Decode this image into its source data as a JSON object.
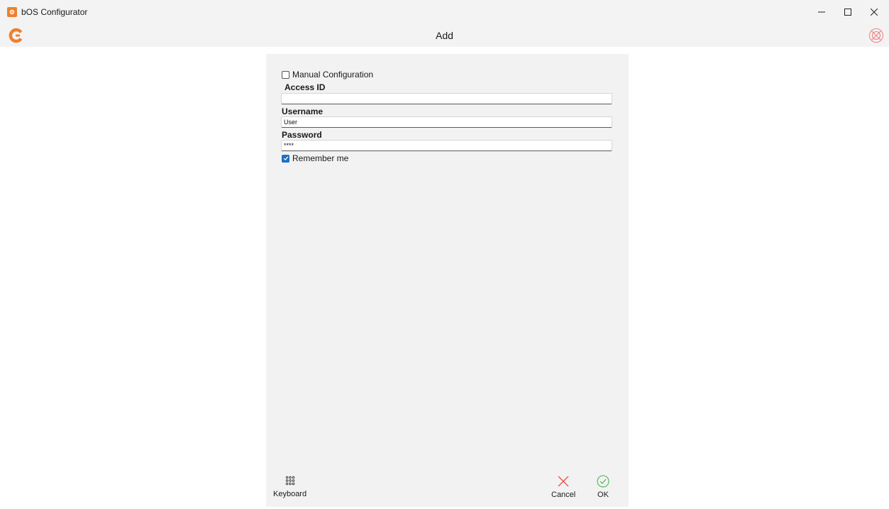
{
  "window": {
    "title": "bOS Configurator",
    "controls": [
      "minimize-icon",
      "maximize-icon",
      "close-icon"
    ]
  },
  "header": {
    "title": "Add",
    "logo_icon": "app-logo-icon",
    "power_icon": "power-close-icon"
  },
  "form": {
    "manual_config_label": "Manual Configuration",
    "manual_config_checked": false,
    "access_id_label": "Access ID",
    "access_id_value": "",
    "username_label": "Username",
    "username_value": "User",
    "password_label": "Password",
    "password_value": "****",
    "remember_label": "Remember me",
    "remember_checked": true
  },
  "footer": {
    "keyboard_label": "Keyboard",
    "cancel_label": "Cancel",
    "ok_label": "OK"
  },
  "colors": {
    "accent": "#f07f2c",
    "checkbox_blue": "#1f6fc5",
    "cancel_red": "#e8534a",
    "ok_green": "#3db54a",
    "panel_bg": "#f2f2f2"
  }
}
